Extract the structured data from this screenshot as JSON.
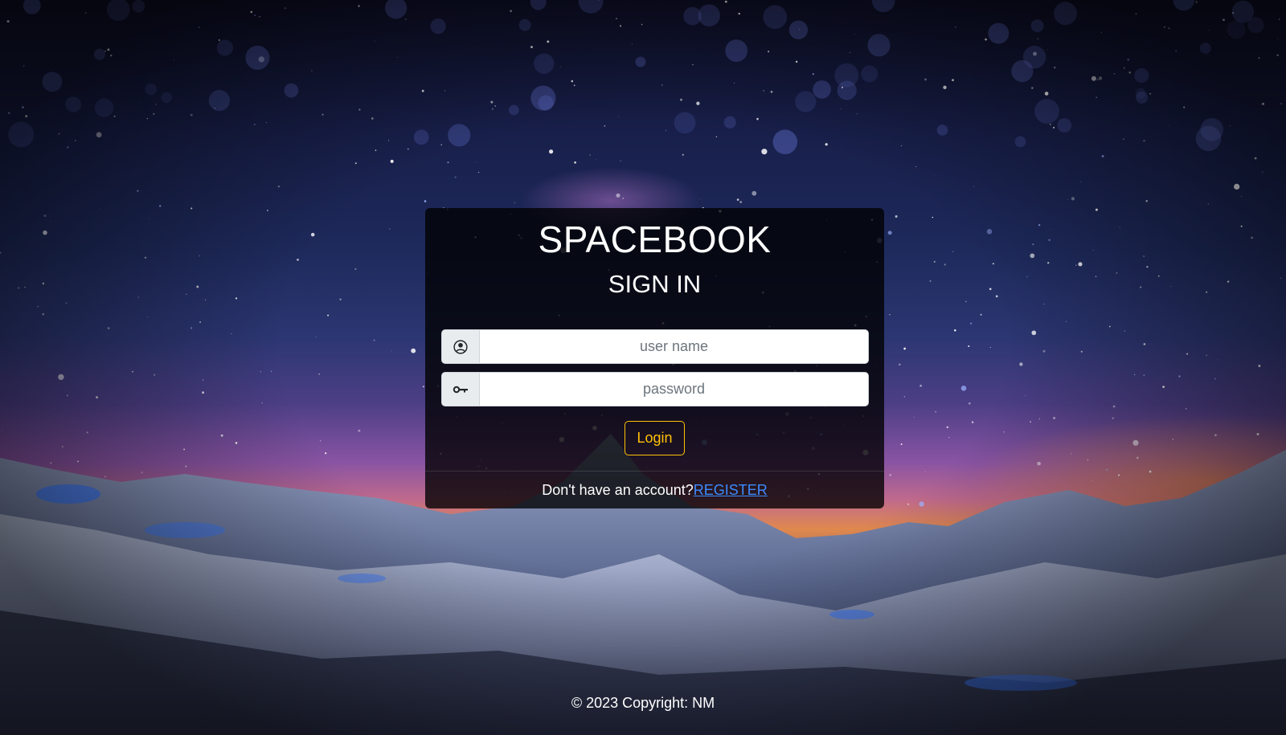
{
  "login_card": {
    "brand": "SPACEBOOK",
    "heading": "SIGN IN",
    "username": {
      "icon": "user-circle-icon",
      "placeholder": "user name",
      "value": ""
    },
    "password": {
      "icon": "key-icon",
      "placeholder": "password",
      "value": ""
    },
    "login_label": "Login",
    "register_prompt": "Don't have an account?",
    "register_link": "REGISTER"
  },
  "footer": {
    "copyright": "© 2023 Copyright: NM"
  },
  "colors": {
    "login_accent": "#ffc107",
    "link": "#3d8bfd",
    "card_bg": "rgba(0,0,0,0.78)"
  }
}
